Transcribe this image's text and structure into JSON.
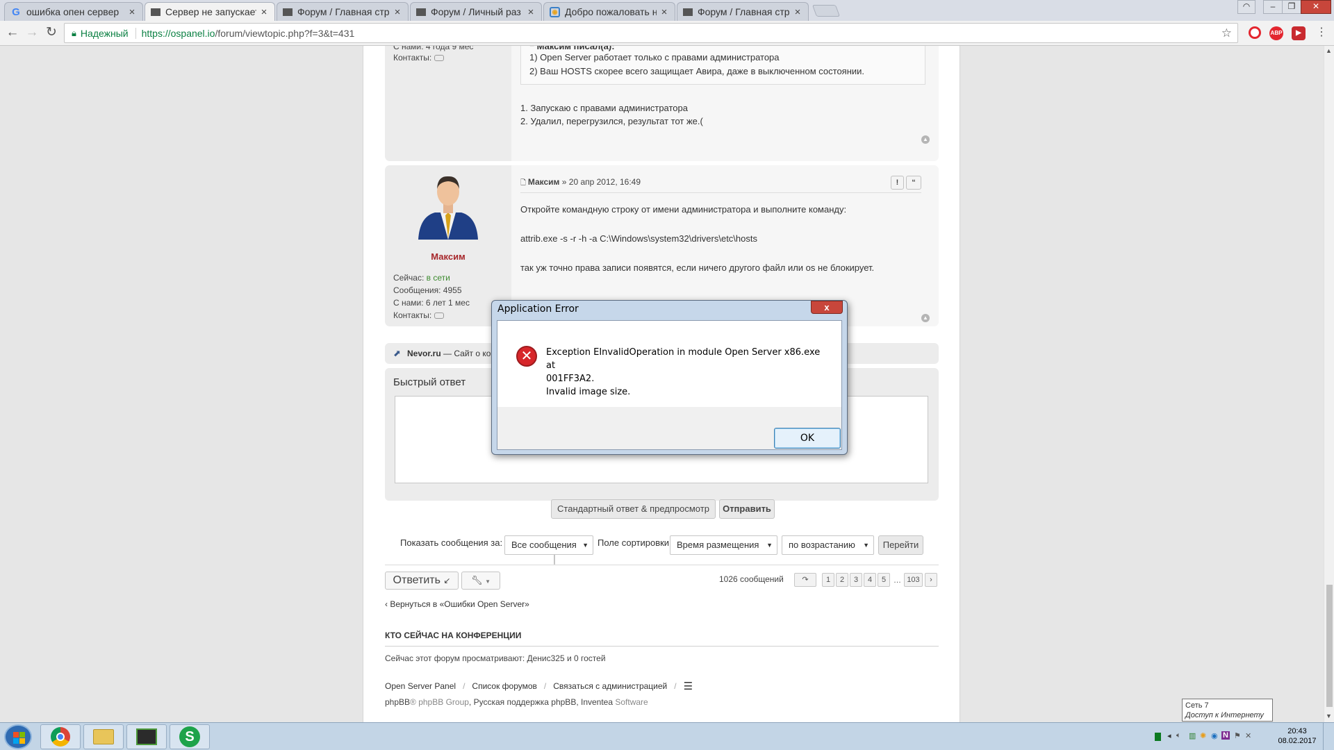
{
  "browser": {
    "tabs": [
      {
        "title": "ошибка опен сервер",
        "icon": "google-icon"
      },
      {
        "title": "Сервер не запускает",
        "icon": "page-icon"
      },
      {
        "title": "Форум / Главная стр",
        "icon": "page-icon"
      },
      {
        "title": "Форум / Личный раз",
        "icon": "page-icon"
      },
      {
        "title": "Добро пожаловать н",
        "icon": "ospanel-icon"
      },
      {
        "title": "Форум / Главная стр",
        "icon": "page-icon"
      }
    ],
    "secure_label": "Надежный",
    "url_host": "https://ospanel.io",
    "url_path": "/forum/viewtopic.php?f=3&t=431"
  },
  "post_prev": {
    "member_for": "С нами: 4 года 9 мес",
    "contacts_label": "Контакты:",
    "quote_author": "Максим писал(а):",
    "quote_lines": [
      "1) Open Server работает только с правами администратора",
      "2) Ваш HOSTS скорее всего защищает Авира, даже в выключенном состоянии."
    ],
    "reply_lines": [
      "1. Запускаю с правами администратора",
      "2. Удалил, перегрузился, результат тот же.("
    ]
  },
  "post_main": {
    "author": "Максим",
    "date": "» 20 апр 2012, 16:49",
    "status_label": "Сейчас:",
    "status_value": "в сети",
    "messages": "Сообщения: 4955",
    "member_for": "С нами: 6 лет 1 мес",
    "contacts_label": "Контакты:",
    "report_btn": "!",
    "quote_btn": "“",
    "body": [
      "Откройте командную строку от имени администратора и выполните команду:",
      "attrib.exe -s -r -h -a C:\\Windows\\system32\\drivers\\etc\\hosts",
      "так уж точно права записи появятся, если ничего другого файл или os не блокирует."
    ]
  },
  "ad": {
    "site": "Nevor.ru",
    "text": "— Сайт о ко"
  },
  "quick_reply": {
    "title": "Быстрый ответ",
    "preview_btn": "Стандартный ответ & предпросмотр",
    "submit_btn": "Отправить"
  },
  "sort_bar": {
    "show_label": "Показать сообщения за:",
    "show_value": "Все сообщения",
    "sort_label": "Поле сортировки",
    "sort_value": "Время размещения",
    "order_value": "по возрастанию",
    "go_btn": "Перейти"
  },
  "actions": {
    "reply_btn": "Ответить",
    "count": "1026 сообщений",
    "pages": [
      "1",
      "2",
      "3",
      "4",
      "5"
    ],
    "ellipsis": "…",
    "last_page": "103",
    "back_link": "‹ Вернуться в «Ошибки Open Server»"
  },
  "online": {
    "title": "КТО СЕЙЧАС НА КОНФЕРЕНЦИИ",
    "text": "Сейчас этот форум просматривают: Денис325 и 0 гостей"
  },
  "footer": {
    "links": [
      "Open Server Panel",
      "Список форумов",
      "Связаться с администрацией"
    ],
    "separator": "/",
    "credits_a": "phpBB",
    "credits_b": "® phpBB Group",
    "credits_c": ", Русская поддержка phpBB, Inventea",
    "credits_d": " Software"
  },
  "dialog": {
    "title": "Application Error",
    "close": "x",
    "line1": "Exception EInvalidOperation in module Open Server x86.exe at",
    "line2": "001FF3A2.",
    "line3": "Invalid image size.",
    "ok": "OK"
  },
  "taskbar": {
    "time": "20:43",
    "date": "08.02.2017",
    "net_title": "Сеть 7",
    "net_status": "Доступ к Интернету"
  },
  "colors": {
    "author_red": "#a6262a",
    "online_green": "#3c8a2e",
    "secure_green": "#0b8043",
    "dialog_error": "#d7262a"
  }
}
